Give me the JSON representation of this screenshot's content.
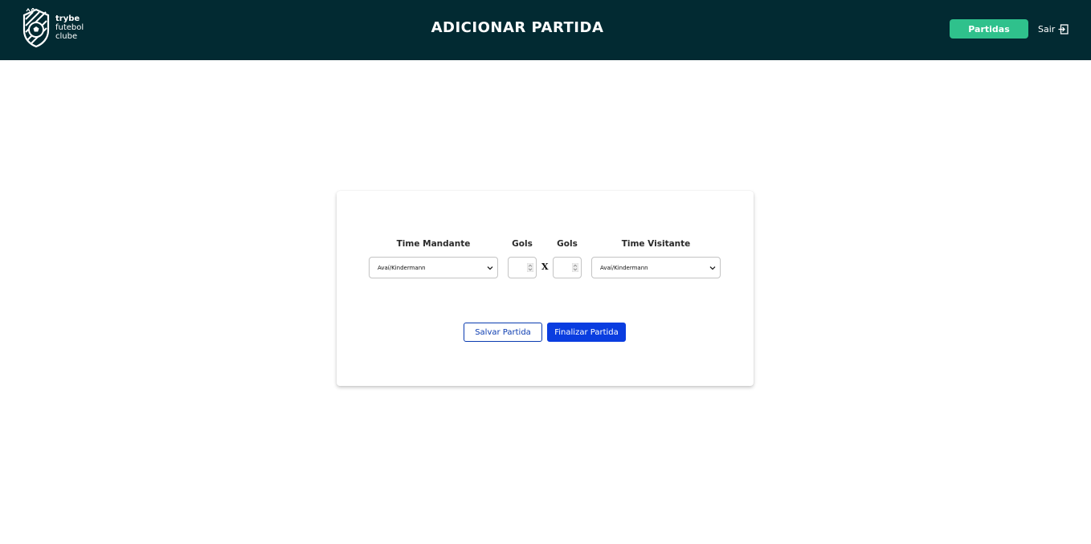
{
  "header": {
    "logo": {
      "line1": "trybe",
      "line2": "futebol",
      "line3": "clube"
    },
    "title": "ADICIONAR PARTIDA",
    "partidas_label": "Partidas",
    "logout_label": "Sair"
  },
  "form": {
    "home_team_label": "Time Mandante",
    "home_goals_label": "Gols",
    "away_goals_label": "Gols",
    "away_team_label": "Time Visitante",
    "home_team_value": "Avaí/Kindermann",
    "away_team_value": "Avaí/Kindermann",
    "home_goals_value": "",
    "away_goals_value": "",
    "separator": "X",
    "save_label": "Salvar Partida",
    "finish_label": "Finalizar Partida"
  },
  "colors": {
    "header_bg": "#022a32",
    "accent_green": "#2fc18c",
    "primary_blue": "#0a3de0"
  },
  "icons": {
    "logo": "shield-ball-icon",
    "logout": "logout-icon",
    "dropdown": "chevron-down-icon",
    "stepper": "spinner-arrows-icon"
  }
}
